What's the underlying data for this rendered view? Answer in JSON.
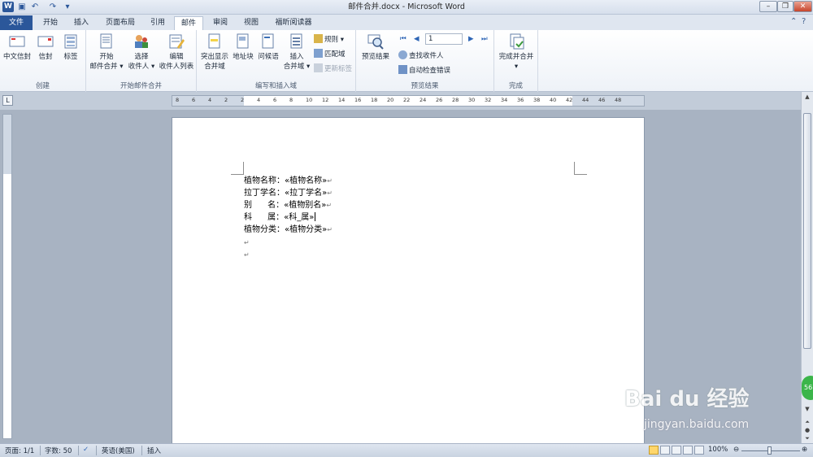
{
  "window": {
    "title": "邮件合并.docx - Microsoft Word",
    "app_icon_letter": "W"
  },
  "tabs": [
    {
      "label": "文件"
    },
    {
      "label": "开始"
    },
    {
      "label": "插入"
    },
    {
      "label": "页面布局"
    },
    {
      "label": "引用"
    },
    {
      "label": "邮件"
    },
    {
      "label": "审阅"
    },
    {
      "label": "视图"
    },
    {
      "label": "福昕阅读器"
    }
  ],
  "ribbon": {
    "create": {
      "label": "创建",
      "buttons": [
        "中文信封",
        "信封",
        "标签"
      ]
    },
    "start": {
      "label": "开始邮件合并",
      "buttons": [
        {
          "line1": "开始",
          "line2": "邮件合并 ▾"
        },
        {
          "line1": "选择",
          "line2": "收件人 ▾"
        },
        {
          "line1": "编辑",
          "line2": "收件人列表"
        }
      ]
    },
    "write": {
      "label": "编写和插入域",
      "buttons": [
        {
          "line1": "突出显示",
          "line2": "合并域"
        },
        {
          "line1": "地址块",
          "line2": ""
        },
        {
          "line1": "问候语",
          "line2": ""
        },
        {
          "line1": "插入",
          "line2": "合并域 ▾"
        }
      ],
      "small": [
        "规则 ▾",
        "匹配域",
        "更新标签"
      ]
    },
    "preview": {
      "label": "预览结果",
      "preview_button": "预览结果",
      "record": "1",
      "small": [
        "查找收件人",
        "自动检查错误"
      ]
    },
    "finish": {
      "label": "完成",
      "button_line1": "完成并合并",
      "button_line2": "▾"
    }
  },
  "ruler_numbers": [
    "8",
    "6",
    "4",
    "2",
    "2",
    "4",
    "6",
    "8",
    "10",
    "12",
    "14",
    "16",
    "18",
    "20",
    "22",
    "24",
    "26",
    "28",
    "30",
    "32",
    "34",
    "36",
    "38",
    "40",
    "42",
    "44",
    "46",
    "48"
  ],
  "document": {
    "lines": [
      {
        "label": "植物名称：",
        "field": "«植物名称»"
      },
      {
        "label": "拉丁学名：",
        "field": "«拉丁学名»"
      },
      {
        "label": "别      名：",
        "field": "«植物别名»"
      },
      {
        "label": "科      属：",
        "field": "«科_属»"
      },
      {
        "label": "植物分类：",
        "field": "«植物分类»"
      }
    ],
    "paragraph_mark": "↵"
  },
  "status": {
    "page": "页面: 1/1",
    "words": "字数: 50",
    "language": "英语(美国)",
    "mode": "插入",
    "zoom": "100%"
  },
  "watermark": {
    "logo": "Bai du 经验",
    "url": "jingyan.baidu.com",
    "badge": "56"
  },
  "colors": {
    "accent": "#2b579a",
    "ribbon_bg": "#eef2f8",
    "workspace": "#a8b3c2"
  }
}
